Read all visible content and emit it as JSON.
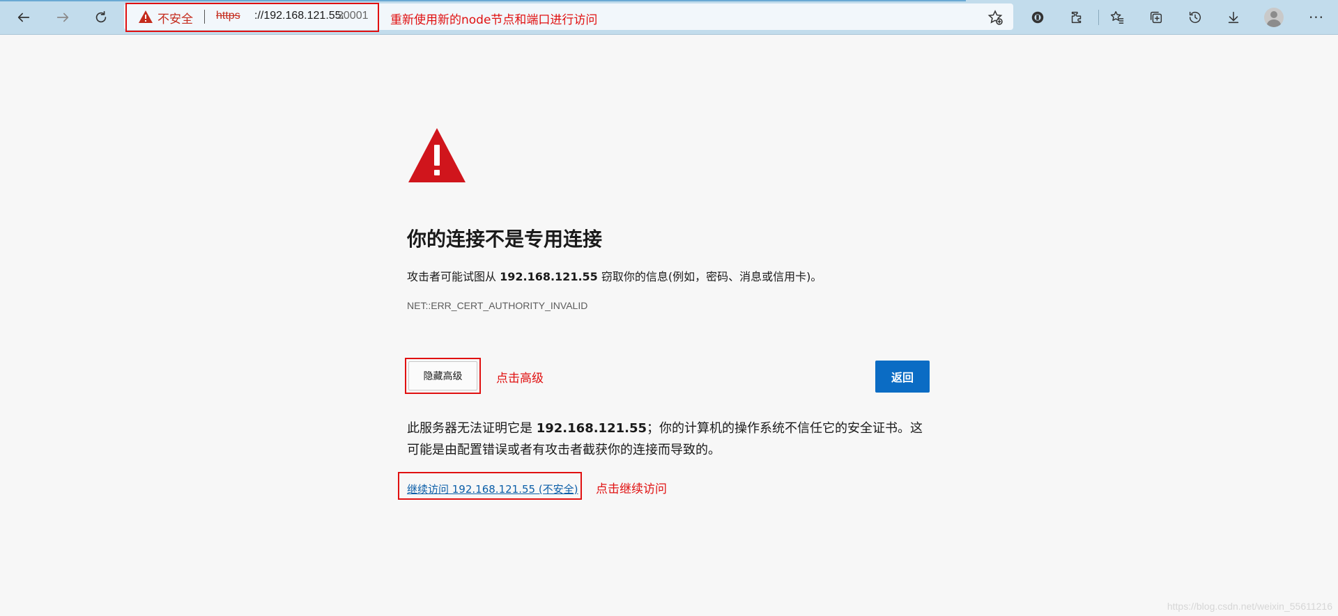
{
  "browser": {
    "security_label": "不安全",
    "url_scheme": "https",
    "url_host": "://192.168.121.55:",
    "url_port": "30001",
    "address_note": "重新使用新的node节点和端口进行访问",
    "icons": {
      "back": "back-arrow-icon",
      "forward": "forward-arrow-icon",
      "refresh": "refresh-icon",
      "favorite": "favorite-star-icon",
      "toolbar": [
        "extension-badge-icon",
        "extensions-puzzle-icon",
        "favorites-icon",
        "collections-icon",
        "history-icon",
        "downloads-icon",
        "profile-avatar",
        "more-icon"
      ]
    }
  },
  "page": {
    "title": "你的连接不是专用连接",
    "desc_prefix": "攻击者可能试图从 ",
    "desc_host": "192.168.121.55",
    "desc_suffix": " 窃取你的信息(例如，密码、消息或信用卡)。",
    "error_code": "NET::ERR_CERT_AUTHORITY_INVALID",
    "hide_advanced_label": "隐藏高级",
    "hide_advanced_note": "点击高级",
    "back_label": "返回",
    "detail_prefix": "此服务器无法证明它是 ",
    "detail_host": "192.168.121.55",
    "detail_suffix": "；你的计算机的操作系统不信任它的安全证书。这可能是由配置错误或者有攻击者截获你的连接而导致的。",
    "continue_link": "继续访问 192.168.121.55 (不安全)",
    "continue_note": "点击继续访问"
  },
  "watermark": "https://blog.csdn.net/weixin_55611216",
  "colors": {
    "toolbar_bg": "#c2dcec",
    "annotation_red": "#e01010",
    "warning_red": "#c42b1c",
    "primary_blue": "#0b6cc4",
    "link_blue": "#0b5ea8"
  }
}
